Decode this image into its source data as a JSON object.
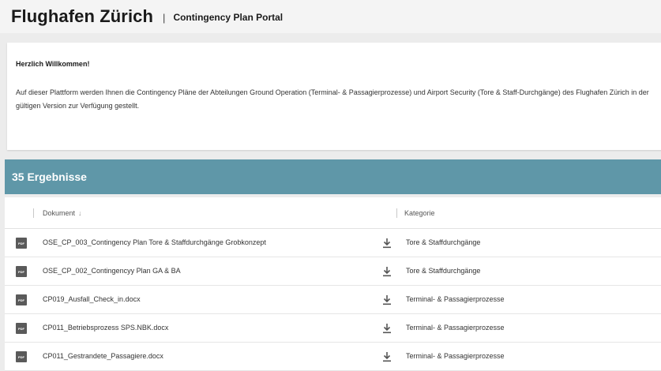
{
  "header": {
    "brand": "Flughafen Zürich",
    "separator": "|",
    "subtitle": "Contingency Plan Portal"
  },
  "welcome": {
    "heading": "Herzlich Willkommen!",
    "text": "Auf dieser Plattform werden Ihnen die Contingency Pläne der Abteilungen Ground Operation (Terminal- & Passagierprozesse) und Airport Security (Tore & Staff-Durchgänge) des Flughafen Zürich in der gültigen Version zur Verfügung gestellt."
  },
  "results": {
    "label": "35 Ergebnisse"
  },
  "table": {
    "columns": {
      "document": "Dokument",
      "sort_arrow": "↓",
      "category": "Kategorie"
    },
    "rows": [
      {
        "icon": "pdf-file-icon",
        "icon_label": "PDF",
        "document": "OSE_CP_003_Contingency Plan Tore & Staffdurchgänge Grobkonzept",
        "category": "Tore & Staffdurchgänge"
      },
      {
        "icon": "pdf-file-icon",
        "icon_label": "PDF",
        "document": "OSE_CP_002_Contingencyy Plan GA & BA",
        "category": "Tore & Staffdurchgänge"
      },
      {
        "icon": "pdf-file-icon",
        "icon_label": "PDF",
        "document": "CP019_Ausfall_Check_in.docx",
        "category": "Terminal- & Passagierprozesse"
      },
      {
        "icon": "pdf-file-icon",
        "icon_label": "PDF",
        "document": "CP011_Betriebsprozess SPS.NBK.docx",
        "category": "Terminal- & Passagierprozesse"
      },
      {
        "icon": "pdf-file-icon",
        "icon_label": "PDF",
        "document": "CP011_Gestrandete_Passagiere.docx",
        "category": "Terminal- & Passagierprozesse"
      }
    ]
  },
  "colors": {
    "results_bar": "#5f97a8",
    "header_bg": "#f4f4f4",
    "page_bg": "#ececec"
  }
}
